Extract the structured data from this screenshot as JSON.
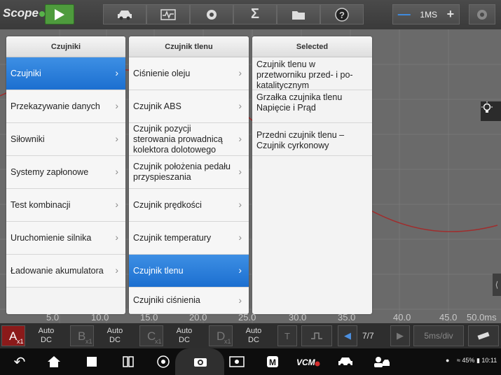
{
  "app": {
    "logo": "Scope"
  },
  "toolbar": {
    "icons": [
      "car-icon",
      "waveform-icon",
      "gear-icon",
      "sigma-icon",
      "folder-icon",
      "help-icon"
    ],
    "timebase": "1MS"
  },
  "scope": {
    "x_ticks": [
      "5.0",
      "10.0",
      "15.0",
      "20.0",
      "25.0",
      "30.0",
      "35.0",
      "40.0",
      "45.0",
      "50.0ms"
    ],
    "trace_color": "#a02d2d"
  },
  "menus": {
    "col1": {
      "title": "Czujniki",
      "items": [
        {
          "label": "Czujniki",
          "selected": true
        },
        {
          "label": "Przekazywanie danych",
          "selected": false
        },
        {
          "label": "Siłowniki",
          "selected": false
        },
        {
          "label": "Systemy zapłonowe",
          "selected": false
        },
        {
          "label": "Test kombinacji",
          "selected": false
        },
        {
          "label": "Uruchomienie silnika",
          "selected": false
        },
        {
          "label": "Ładowanie akumulatora",
          "selected": false
        }
      ]
    },
    "col2": {
      "title": "Czujnik tlenu",
      "items": [
        {
          "label": "Ciśnienie oleju",
          "selected": false
        },
        {
          "label": "Czujnik ABS",
          "selected": false
        },
        {
          "label": "Czujnik pozycji sterowania prowadnicą kolektora dolotowego",
          "selected": false
        },
        {
          "label": "Czujnik położenia pedału przyspieszania",
          "selected": false
        },
        {
          "label": "Czujnik prędkości",
          "selected": false
        },
        {
          "label": "Czujnik temperatury",
          "selected": false
        },
        {
          "label": "Czujnik tlenu",
          "selected": true
        },
        {
          "label": "Czujniki ciśnienia",
          "selected": false
        }
      ]
    },
    "col3": {
      "title": "Selected",
      "items": [
        {
          "label": "Czujnik tlenu w przetworniku przed- i po-katalitycznym"
        },
        {
          "label": "Grzałka czujnika tlenu Napięcie i Prąd"
        },
        {
          "label": "Przedni czujnik tlenu – Czujnik cyrkonowy"
        }
      ]
    }
  },
  "channels": [
    {
      "letter": "A",
      "sub": "x1",
      "mode": "Auto",
      "coupling": "DC",
      "active": true
    },
    {
      "letter": "B",
      "sub": "x1",
      "mode": "Auto",
      "coupling": "DC",
      "active": false
    },
    {
      "letter": "C",
      "sub": "x1",
      "mode": "Auto",
      "coupling": "DC",
      "active": false
    },
    {
      "letter": "D",
      "sub": "x1",
      "mode": "Auto",
      "coupling": "DC",
      "active": false
    }
  ],
  "bottom": {
    "page": "7/7",
    "tdiv": "5ms/div",
    "t_label": "T"
  },
  "status": {
    "battery": "45%",
    "time": "10:11"
  }
}
